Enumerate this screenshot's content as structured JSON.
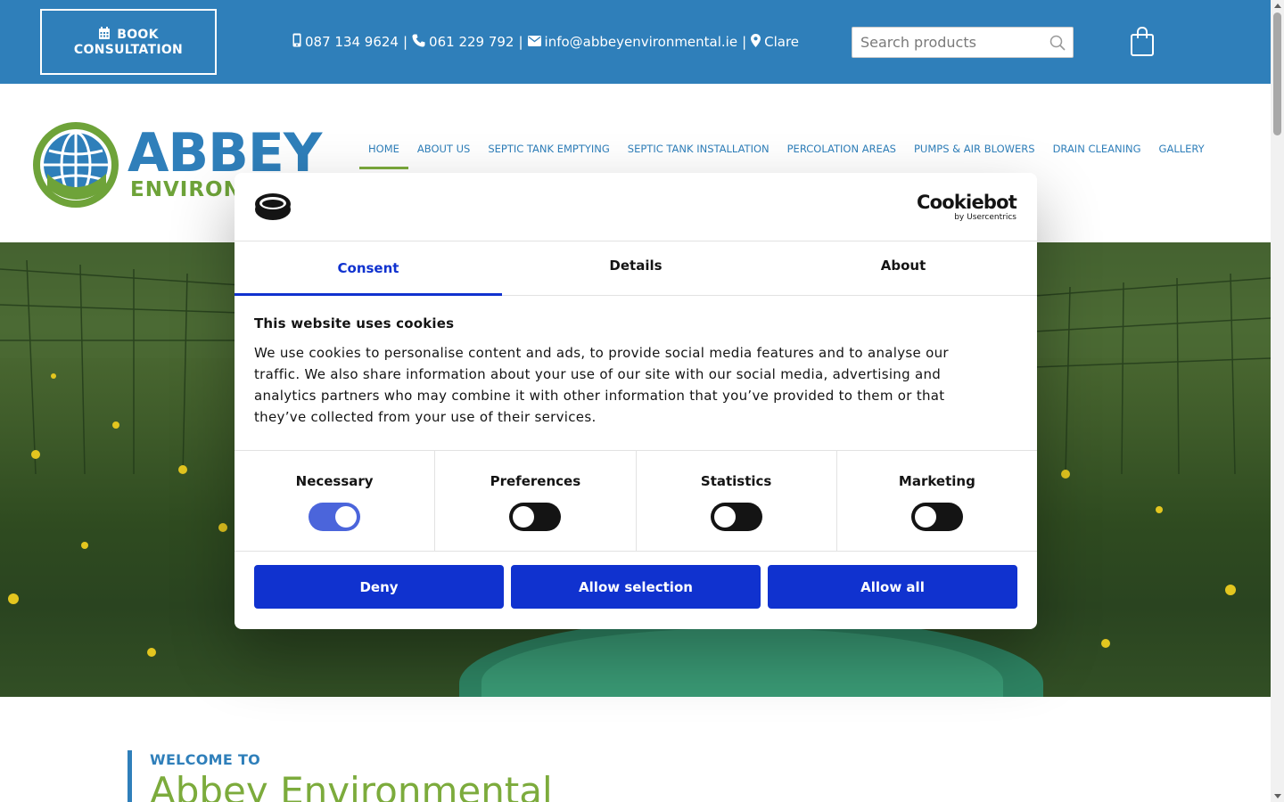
{
  "colors": {
    "brand_blue": "#2f7fba",
    "brand_green": "#7cab3c",
    "cookiebot_blue": "#1032cf"
  },
  "topbar": {
    "book_line1": "BOOK",
    "book_line2": "CONSULTATION",
    "mobile": "087 134 9624",
    "phone": "061 229 792",
    "email": "info@abbeyenvironmental.ie",
    "location": "Clare",
    "separator": "|",
    "search_placeholder": "Search products",
    "icons": {
      "calendar": "calendar-icon",
      "mobile": "mobile-phone-icon",
      "phone": "phone-icon",
      "email": "envelope-icon",
      "location": "map-marker-icon",
      "search": "search-icon",
      "cart": "shopping-bag-icon"
    }
  },
  "logo": {
    "text": "ABBEY",
    "sub": "ENVIRONM"
  },
  "nav": {
    "items": [
      {
        "label": "HOME",
        "active": true
      },
      {
        "label": "ABOUT US"
      },
      {
        "label": "SEPTIC TANK EMPTYING"
      },
      {
        "label": "SEPTIC TANK INSTALLATION"
      },
      {
        "label": "PERCOLATION AREAS"
      },
      {
        "label": "PUMPS & AIR BLOWERS"
      },
      {
        "label": "DRAIN CLEANING"
      },
      {
        "label": "GALLERY"
      }
    ]
  },
  "welcome": {
    "kicker": "WELCOME TO",
    "title": "Abbey Environmental"
  },
  "cookie": {
    "brand": "Cookiebot",
    "brand_by": "by Usercentrics",
    "tabs": [
      "Consent",
      "Details",
      "About"
    ],
    "active_tab": "Consent",
    "heading": "This website uses cookies",
    "body": "We use cookies to personalise content and ads, to provide social media features and to analyse our traffic. We also share information about your use of our site with our social media, advertising and analytics partners who may combine it with other information that you’ve provided to them or that they’ve collected from your use of their services.",
    "toggles": [
      {
        "label": "Necessary",
        "on": true
      },
      {
        "label": "Preferences",
        "on": false
      },
      {
        "label": "Statistics",
        "on": false
      },
      {
        "label": "Marketing",
        "on": false
      }
    ],
    "buttons": {
      "deny": "Deny",
      "allow_selection": "Allow selection",
      "allow_all": "Allow all"
    }
  }
}
